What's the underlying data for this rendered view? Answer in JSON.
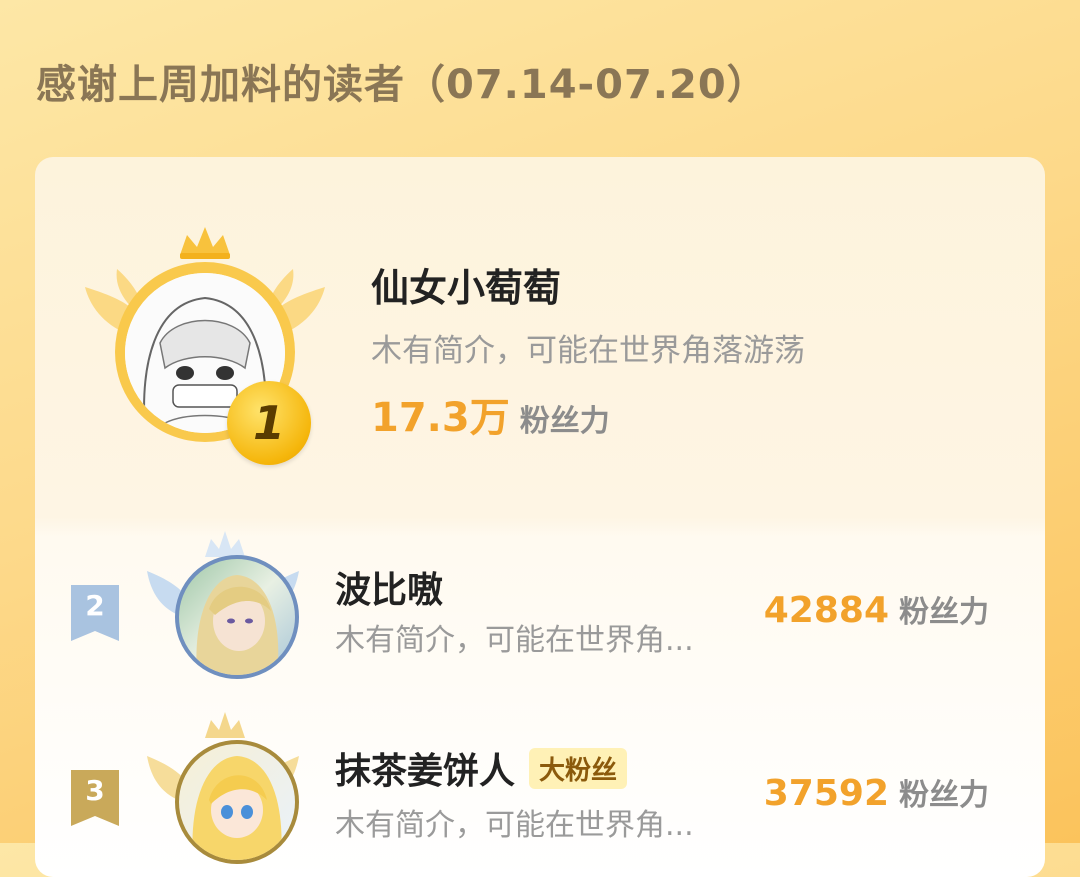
{
  "header": {
    "title": "感谢上周加料的读者（07.14-07.20）"
  },
  "colors": {
    "accent": "#f2a22b",
    "gold": "#f5b60b",
    "silver": "#a9c3e0",
    "bronze": "#c9a95a"
  },
  "top_reader": {
    "rank": "1",
    "name": "仙女小萄萄",
    "bio": "木有简介，可能在世界角落游荡",
    "fans_value": "17.3万",
    "fans_label": "粉丝力"
  },
  "readers": [
    {
      "rank": "2",
      "name": "波比嗷",
      "tag": "",
      "bio": "木有简介，可能在世界角...",
      "fans_value": "42884",
      "fans_label": "粉丝力"
    },
    {
      "rank": "3",
      "name": "抹茶姜饼人",
      "tag": "大粉丝",
      "bio": "木有简介，可能在世界角...",
      "fans_value": "37592",
      "fans_label": "粉丝力"
    }
  ]
}
